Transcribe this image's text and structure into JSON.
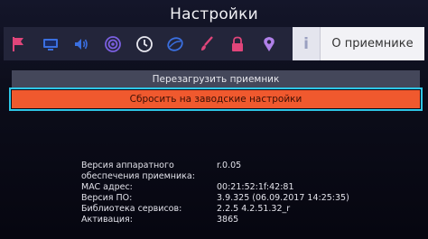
{
  "header": {
    "title": "Настройки"
  },
  "iconbar": {
    "icons": [
      {
        "name": "flag-icon",
        "color": "#e0457a"
      },
      {
        "name": "monitor-icon",
        "color": "#3a6fe0"
      },
      {
        "name": "audio-icon",
        "color": "#3a6fe0"
      },
      {
        "name": "broadcast-icon",
        "color": "#7a5fe0"
      },
      {
        "name": "clock-icon",
        "color": "#e8e8f0"
      },
      {
        "name": "globe-icon",
        "color": "#3a6fe0"
      },
      {
        "name": "brush-icon",
        "color": "#e0457a"
      },
      {
        "name": "lock-icon",
        "color": "#e0457a"
      },
      {
        "name": "location-pin-icon",
        "color": "#b080e8"
      }
    ],
    "info_tab": {
      "icon": "i",
      "label": "О приемнике"
    }
  },
  "menu": {
    "reboot_label": "Перезагрузить приемник",
    "reset_label": "Сбросить на заводские настройки"
  },
  "info": {
    "rows": [
      {
        "key": "Версия аппаратного",
        "value": "r.0.05"
      },
      {
        "key": "обеспечения приемника:",
        "value": ""
      },
      {
        "key": "MAC адрес:",
        "value": "00:21:52:1f:42:81"
      },
      {
        "key": "Версия ПО:",
        "value": "3.9.325 (06.09.2017 14:25:35)"
      },
      {
        "key": "Библиотека сервисов:",
        "value": "2.2.5 4.2.51.32_r"
      },
      {
        "key": "Активация:",
        "value": "3865"
      }
    ]
  },
  "colors": {
    "accent_orange": "#f0592e",
    "focus_cyan": "#2ec6e6",
    "bar_bg": "#23253a"
  }
}
